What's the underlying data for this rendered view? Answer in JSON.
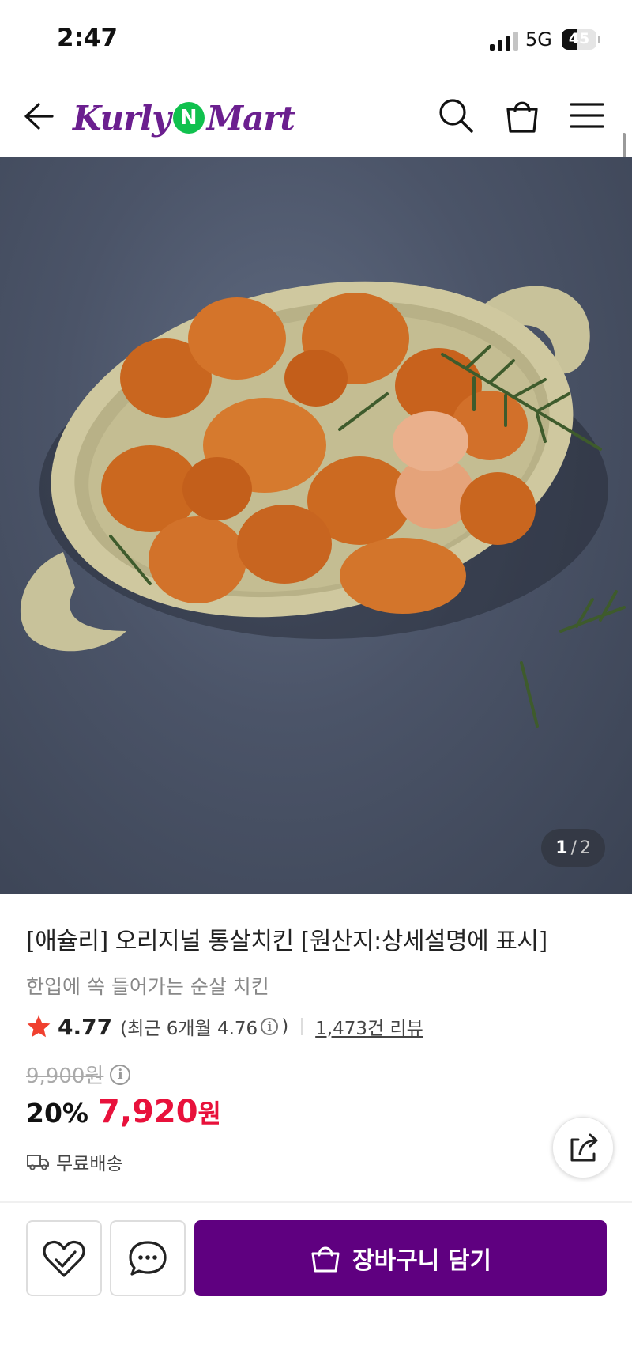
{
  "status_bar": {
    "time": "2:47",
    "network": "5G",
    "battery": "45",
    "battery_level": 0.45,
    "signal_bars": 3,
    "signal_bars_max": 4
  },
  "header": {
    "logo_left": "Kurly",
    "logo_badge": "N",
    "logo_right": "Mart",
    "logo_color": "#6b1f8f",
    "badge_color": "#10c14e",
    "icons": [
      "back-arrow-icon",
      "search-icon",
      "shopping-bag-icon",
      "menu-icon"
    ]
  },
  "gallery": {
    "current": "1",
    "separator": "/",
    "total": "2"
  },
  "product": {
    "title": "[애슐리] 오리지널 통살치킨 [원산지:상세설명에 표시]",
    "subtitle": "한입에 쏙 들어가는 순살 치킨",
    "rating": "4.77",
    "recent_rating_open": "(최근 6개월 4.76",
    "recent_rating_close": ")",
    "review_count": "1,473건 리뷰",
    "original_price": "9,900원",
    "discount": "20%",
    "price": "7,920",
    "currency": "원",
    "delivery": "무료배송",
    "price_color": "#e8113b",
    "star_color": "#f0402f"
  },
  "bottom_bar": {
    "cart_label": "장바구니 담기",
    "cart_color": "#5f0080",
    "wishlist_icon": "heart-icon",
    "inquiry_icon": "chat-bubble-icon"
  }
}
